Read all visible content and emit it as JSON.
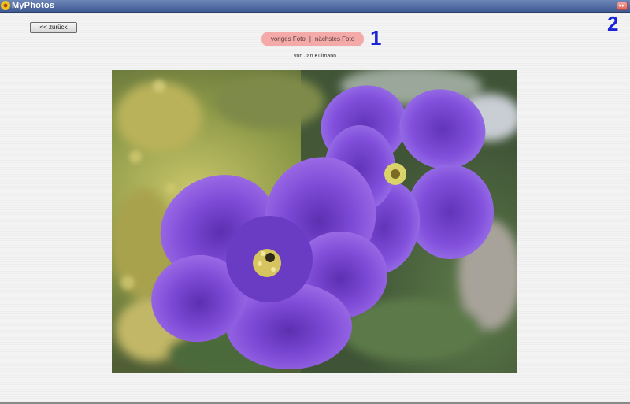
{
  "app": {
    "title": "MyPhotos"
  },
  "toolbar": {
    "back_label": "<< zurück",
    "corner_symbol": "▸▸"
  },
  "nav": {
    "prev_label": "voriges Foto",
    "separator": "|",
    "next_label": "nächstes Foto"
  },
  "annotations": {
    "one": "1",
    "two": "2"
  },
  "photo": {
    "credit": "von Jan Kulmann"
  },
  "colors": {
    "titlebar": "#4a66a0",
    "nav_pill": "#f3aaa8",
    "annotation": "#1a24d6"
  }
}
